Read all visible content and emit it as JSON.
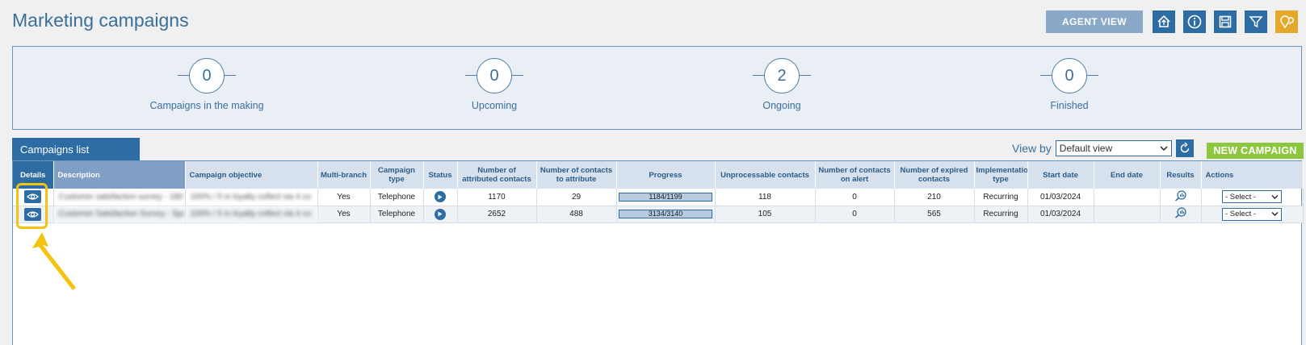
{
  "header": {
    "title": "Marketing campaigns",
    "agent_view_label": "AGENT VIEW",
    "icons": [
      "home-upload-icon",
      "info-icon",
      "save-icon",
      "filter-icon",
      "location-help-icon"
    ]
  },
  "kpis": [
    {
      "value": "0",
      "label": "Campaigns in the making"
    },
    {
      "value": "0",
      "label": "Upcoming"
    },
    {
      "value": "2",
      "label": "Ongoing"
    },
    {
      "value": "0",
      "label": "Finished"
    }
  ],
  "tab_label": "Campaigns list",
  "view_by": {
    "label": "View by",
    "value": "Default view"
  },
  "new_campaign_label": "NEW CAMPAIGN",
  "columns": {
    "details": "Details",
    "description": "Description",
    "objective": "Campaign objective",
    "multi_branch": "Multi-branch",
    "campaign_type": "Campaign type",
    "status": "Status",
    "attributed": "Number of attributed contacts",
    "to_attribute": "Number of contacts to attribute",
    "progress": "Progress",
    "unprocessable": "Unprocessable contacts",
    "on_alert": "Number of contacts on alert",
    "expired": "Number of expired contacts",
    "implementation": "Implementation type",
    "start_date": "Start date",
    "end_date": "End date",
    "results": "Results",
    "actions": "Actions"
  },
  "rows": [
    {
      "description": "Customer satisfaction survey - 180",
      "objective": "100% / 5 in loyalty collect via 4 co",
      "multi_branch": "Yes",
      "campaign_type": "Telephone",
      "attributed": "1170",
      "to_attribute": "29",
      "progress_text": "1184/1199",
      "progress_fraction": 0.9875,
      "unprocessable": "118",
      "on_alert": "0",
      "expired": "210",
      "implementation": "Recurring",
      "start_date": "01/03/2024",
      "end_date": "",
      "action_value": "- Select -"
    },
    {
      "description": "Customer Satisfaction Survey - Spare",
      "objective": "100% / 5 in loyalty collect via 4 co",
      "multi_branch": "Yes",
      "campaign_type": "Telephone",
      "attributed": "2652",
      "to_attribute": "488",
      "progress_text": "3134/3140",
      "progress_fraction": 0.998,
      "unprocessable": "105",
      "on_alert": "0",
      "expired": "565",
      "implementation": "Recurring",
      "start_date": "01/03/2024",
      "end_date": "",
      "action_value": "- Select -"
    }
  ],
  "colors": {
    "primary": "#2e6da4",
    "header_light": "#d7e1ee",
    "accent_green": "#8dc63f",
    "accent_orange": "#e4a92b",
    "highlight": "#f4c310"
  }
}
